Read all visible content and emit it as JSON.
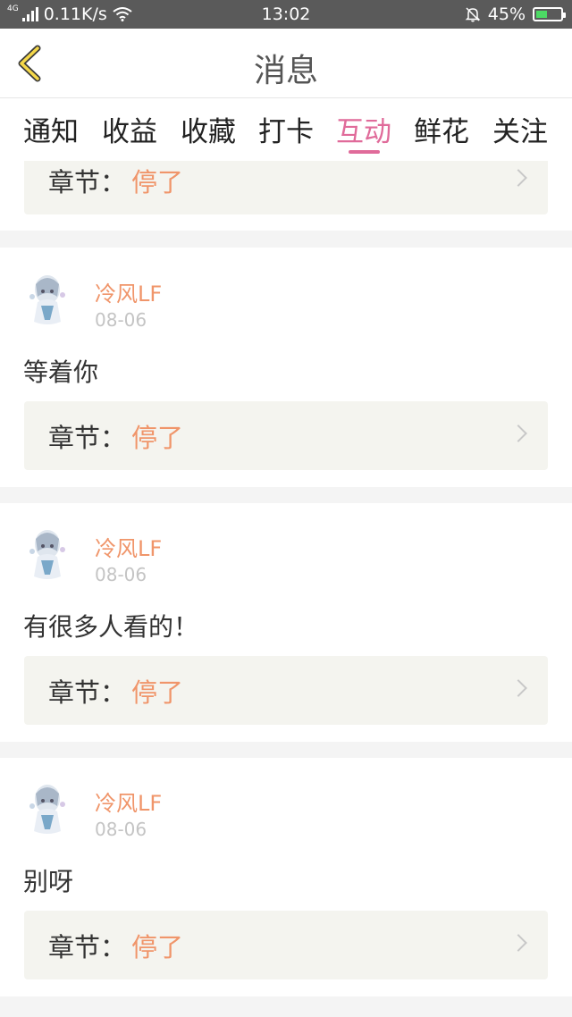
{
  "status_bar": {
    "network_type": "4G",
    "speed": "0.11K/s",
    "time": "13:02",
    "battery": "45%"
  },
  "header": {
    "title": "消息"
  },
  "tabs": [
    {
      "label": "通知"
    },
    {
      "label": "收益"
    },
    {
      "label": "收藏"
    },
    {
      "label": "打卡"
    },
    {
      "label": "互动",
      "active": true
    },
    {
      "label": "鲜花"
    },
    {
      "label": "关注"
    }
  ],
  "colors": {
    "accent": "#e06b9a",
    "username": "#f0956a",
    "chapter_bg": "#f4f4ef"
  },
  "partial_item": {
    "chapter_label": "章节：",
    "chapter_title": "停了"
  },
  "items": [
    {
      "user": "冷风LF",
      "date": "08-06",
      "message": "等着你",
      "chapter_label": "章节：",
      "chapter_title": "停了"
    },
    {
      "user": "冷风LF",
      "date": "08-06",
      "message": "有很多人看的！",
      "chapter_label": "章节：",
      "chapter_title": "停了"
    },
    {
      "user": "冷风LF",
      "date": "08-06",
      "message": "别呀",
      "chapter_label": "章节：",
      "chapter_title": "停了"
    }
  ]
}
